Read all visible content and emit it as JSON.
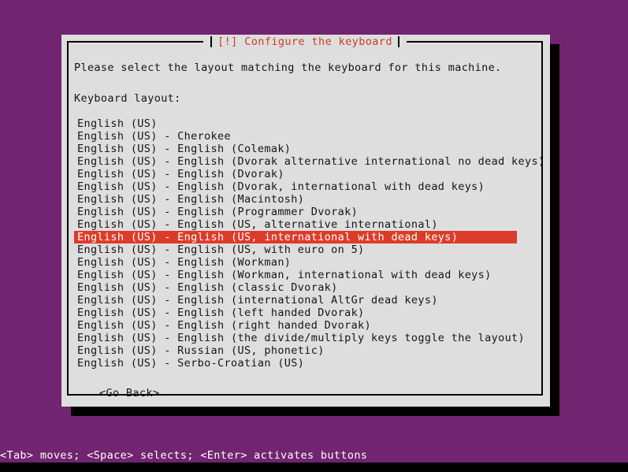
{
  "screen": {
    "background_color": "#712470",
    "bottom_strip_color": "#000000"
  },
  "dialog": {
    "title": "[!] Configure the keyboard",
    "title_color": "#cc3b28",
    "background_color": "#dedede",
    "border_color": "#000000",
    "prompt": "Please select the layout matching the keyboard for this machine.",
    "list_label": "Keyboard layout:",
    "selection_highlight_color": "#dd3b2a",
    "selection_text_color": "#ffffff",
    "selected_index": 9,
    "layouts": [
      "English (US)",
      "English (US) - Cherokee",
      "English (US) - English (Colemak)",
      "English (US) - English (Dvorak alternative international no dead keys)",
      "English (US) - English (Dvorak)",
      "English (US) - English (Dvorak, international with dead keys)",
      "English (US) - English (Macintosh)",
      "English (US) - English (Programmer Dvorak)",
      "English (US) - English (US, alternative international)",
      "English (US) - English (US, international with dead keys)",
      "English (US) - English (US, with euro on 5)",
      "English (US) - English (Workman)",
      "English (US) - English (Workman, international with dead keys)",
      "English (US) - English (classic Dvorak)",
      "English (US) - English (international AltGr dead keys)",
      "English (US) - English (left handed Dvorak)",
      "English (US) - English (right handed Dvorak)",
      "English (US) - English (the divide/multiply keys toggle the layout)",
      "English (US) - Russian (US, phonetic)",
      "English (US) - Serbo-Croatian (US)"
    ],
    "go_back_label": "<Go Back>"
  },
  "status_bar": {
    "text": "<Tab> moves; <Space> selects; <Enter> activates buttons",
    "text_color": "#ffffff"
  }
}
